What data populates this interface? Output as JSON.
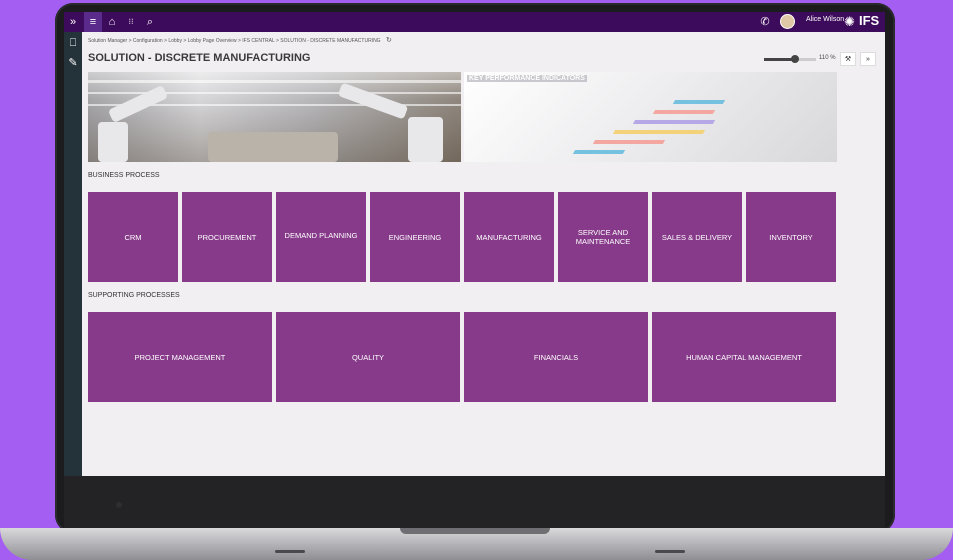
{
  "app": {
    "user_name": "Alice Wilson",
    "logo": "IFS",
    "breadcrumb": "Solution Manager > Configuration > Lobby > Lobby Page Overview > IFS CENTRAL > SOLUTION - DISCRETE MANUFACTURING",
    "page_title": "SOLUTION - DISCRETE MANUFACTURING",
    "zoom_label": "110 %",
    "zoom_level_percent": 110,
    "accent_color": "#3d0b5b",
    "tile_color": "#873a8a"
  },
  "icons": {
    "expand": "»",
    "menu": "≡",
    "home": "⌂",
    "apps": "⁝⁝",
    "search": "⌕",
    "phone": "✆",
    "bookmark": "⎕",
    "edit": "✎",
    "refresh": "↻",
    "wrench": "⚒",
    "double_arrow": "»",
    "burst": "✺"
  },
  "hero": {
    "kpi_title": "KEY PERFORMANCE INDICATORS"
  },
  "business_process": {
    "label": "BUSINESS PROCESS",
    "tiles": [
      "CRM",
      "PROCUREMENT",
      "DEMAND PLANNING",
      "ENGINEERING",
      "MANUFACTURING",
      "SERVICE AND MAINTENANCE",
      "SALES & DELIVERY",
      "INVENTORY"
    ]
  },
  "supporting_processes": {
    "label": "SUPPORTING PROCESSES",
    "tiles": [
      "PROJECT MANAGEMENT",
      "QUALITY",
      "FINANCIALS",
      "HUMAN CAPITAL MANAGEMENT"
    ]
  }
}
